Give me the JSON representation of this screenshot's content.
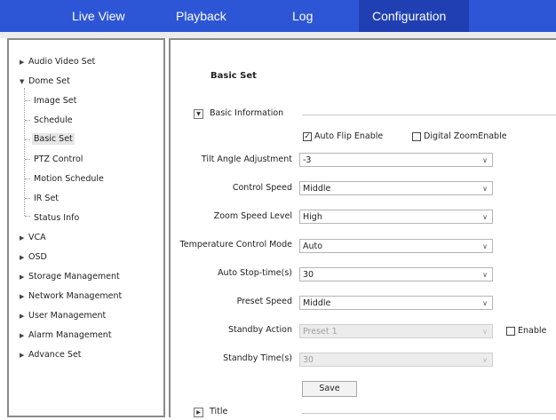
{
  "nav": {
    "tabs": [
      {
        "label": "Live View"
      },
      {
        "label": "Playback"
      },
      {
        "label": "Log"
      },
      {
        "label": "Configuration"
      }
    ]
  },
  "tree": {
    "audio_video_set": "Audio Video Set",
    "dome_set": "Dome Set",
    "children": [
      "Image Set",
      "Schedule",
      "Basic Set",
      "PTZ Control",
      "Motion Schedule",
      "IR Set",
      "Status Info"
    ],
    "after": [
      "VCA",
      "OSD",
      "Storage Management",
      "Network Management",
      "User Management",
      "Alarm Management",
      "Advance Set"
    ]
  },
  "main": {
    "title": "Basic Set",
    "section_basic": "Basic Information",
    "section_title": "Title",
    "auto_flip_label": "Auto Flip Enable",
    "auto_flip_checked": true,
    "digital_zoom_label": "Digital ZoomEnable",
    "digital_zoom_checked": false,
    "fields": [
      {
        "label": "Tilt Angle Adjustment",
        "value": "-3"
      },
      {
        "label": "Control Speed",
        "value": "Middle"
      },
      {
        "label": "Zoom Speed Level",
        "value": "High"
      },
      {
        "label": "Temperature Control Mode",
        "value": "Auto"
      },
      {
        "label": "Auto Stop-time(s)",
        "value": "30"
      },
      {
        "label": "Preset Speed",
        "value": "Middle"
      },
      {
        "label": "Standby Action",
        "value": "Preset 1"
      },
      {
        "label": "Standby Time(s)",
        "value": "30"
      }
    ],
    "standby_enable_label": "Enable",
    "standby_enable_checked": false,
    "save_label": "Save",
    "check_glyph": "✓"
  },
  "icons": {
    "collapsed": "▶",
    "expanded": "▼",
    "dropdown": "∨"
  }
}
